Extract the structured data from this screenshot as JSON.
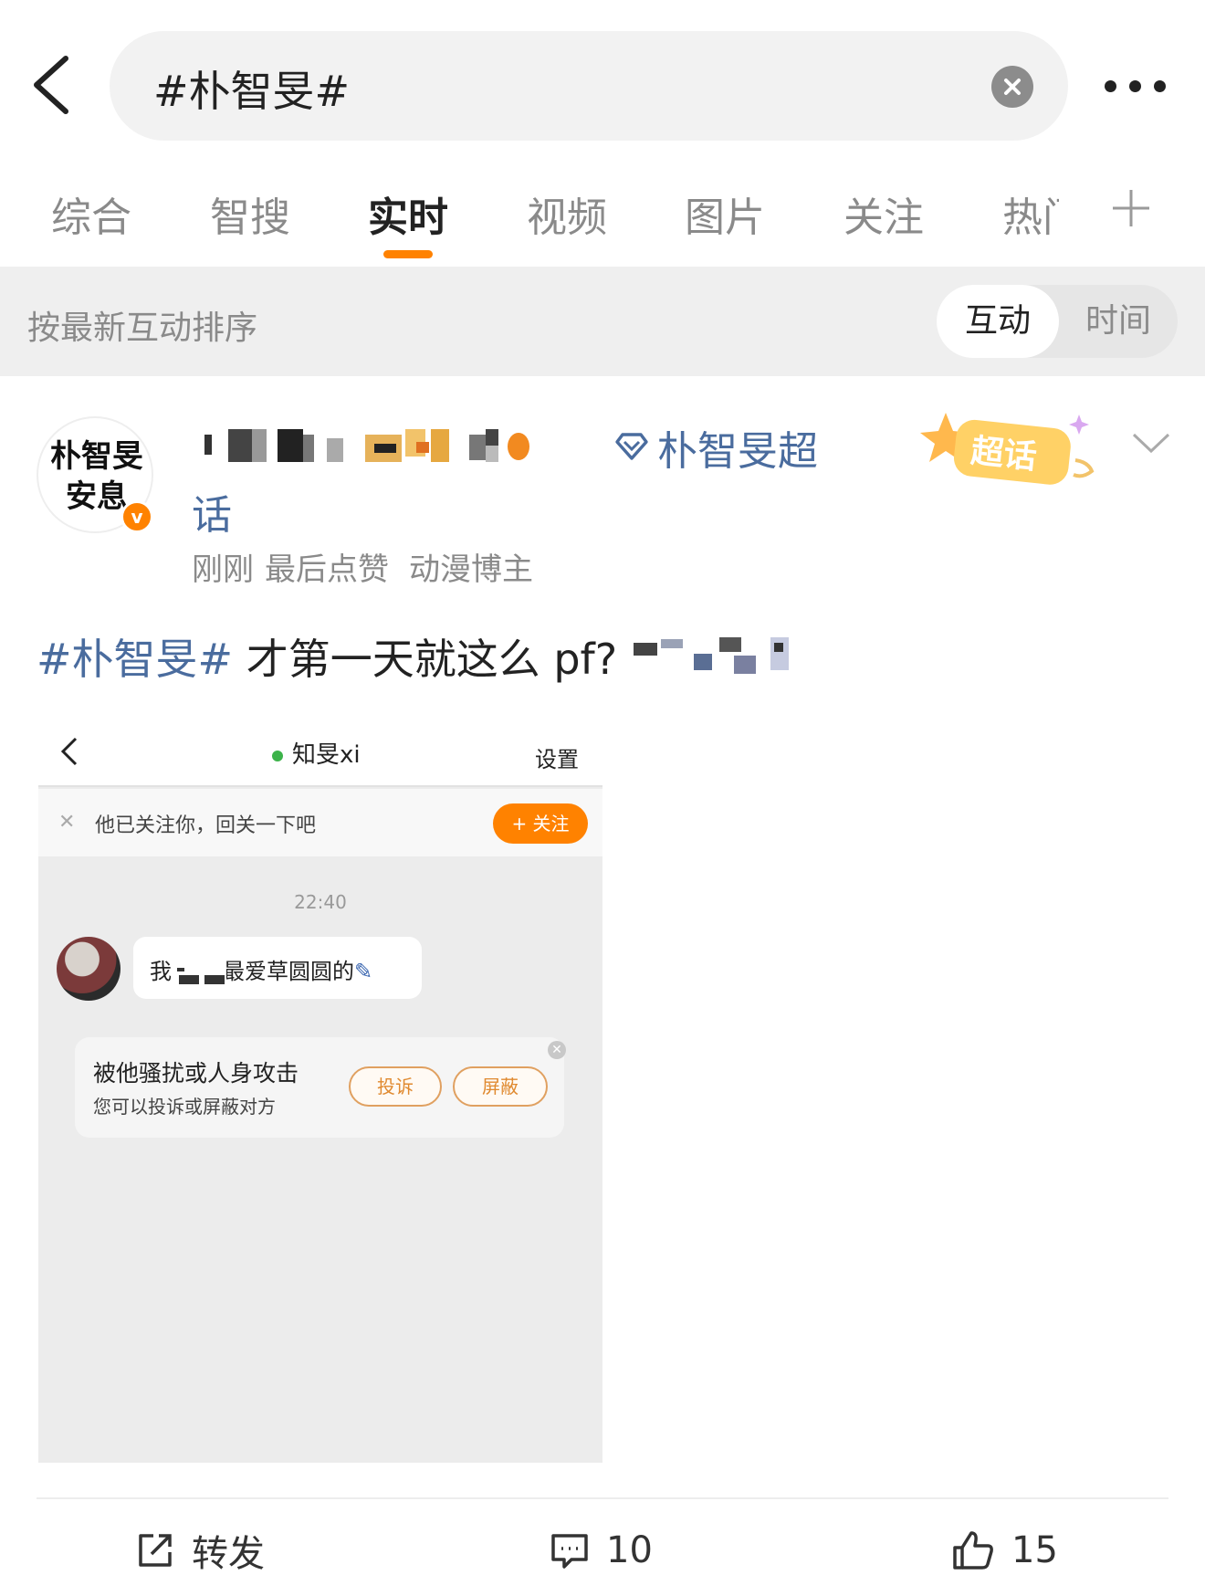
{
  "search": {
    "query": "#朴智旻#"
  },
  "tabs": [
    {
      "label": "综合"
    },
    {
      "label": "智搜"
    },
    {
      "label": "实时",
      "active": true
    },
    {
      "label": "视频"
    },
    {
      "label": "图片"
    },
    {
      "label": "关注"
    },
    {
      "label": "热门"
    }
  ],
  "sort": {
    "label": "按最新互动排序",
    "option_interaction": "互动",
    "option_time": "时间"
  },
  "post": {
    "avatar_text": "朴智旻安息",
    "verified_mark": "v",
    "source_line1": "朴智旻超",
    "source_line2": "话",
    "badge_label": "超话",
    "meta_time": "刚刚",
    "meta_action": "最后点赞",
    "meta_tag": "动漫博主",
    "hashtag": "#朴智旻#",
    "text": " 才第一天就这么 pf?",
    "image": {
      "chat_title": "知旻xi",
      "settings": "设置",
      "follow_tip": "他已关注你，回关一下吧",
      "follow_button": "+ 关注",
      "time": "22:40",
      "message_prefix": "我",
      "message_suffix": "最爱草圆圆的",
      "warn_title": "被他骚扰或人身攻击",
      "warn_sub": "您可以投诉或屏蔽对方",
      "report_button": "投诉",
      "block_button": "屏蔽"
    }
  },
  "actions": {
    "repost": "转发",
    "comments": "10",
    "likes": "15"
  },
  "colors": {
    "accent": "#ff8200",
    "link": "#4a6c9e",
    "muted": "#8a8a8a"
  }
}
